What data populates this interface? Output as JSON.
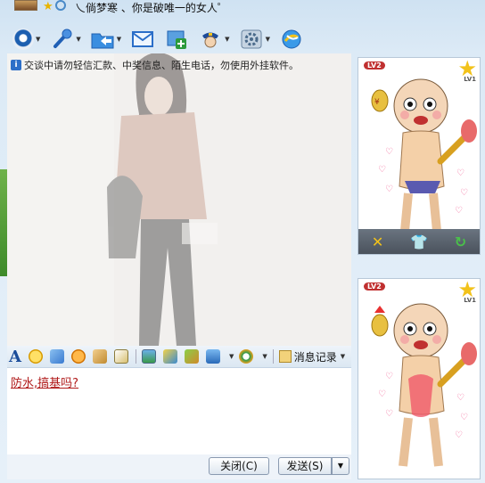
{
  "title": {
    "text": "乀倘梦寒 、你是破唯一的女人゜"
  },
  "toolbar": {
    "items": [
      {
        "icon": "webcam-icon",
        "has_menu": true,
        "color": "#2a6ec8"
      },
      {
        "icon": "microphone-icon",
        "has_menu": true,
        "color": "#3a7ad0"
      },
      {
        "icon": "folder-icon",
        "has_menu": true,
        "color": "#2a7ad8"
      },
      {
        "icon": "email-icon",
        "has_menu": false,
        "color": "#4a90d8"
      },
      {
        "icon": "add-app-icon",
        "has_menu": false,
        "color": "#2c8a3c"
      },
      {
        "icon": "police-icon",
        "has_menu": true,
        "color": "#2a5ca8"
      },
      {
        "icon": "gear-icon",
        "has_menu": true,
        "color": "#5a7a98"
      },
      {
        "icon": "browser-icon",
        "has_menu": false,
        "color": "#2a8ad8"
      }
    ]
  },
  "chat": {
    "notice": "交谈中请勿轻信汇款、中奖信息、陌生电话，勿使用外挂软件。"
  },
  "format_bar": {
    "history_label": "消息记录"
  },
  "input": {
    "draft": "防水,搞基吗?"
  },
  "buttons": {
    "close": "关闭(C)",
    "send": "发送(S)"
  },
  "profile_panels": {
    "level_badge": "LV2",
    "star_level": "LV1"
  }
}
